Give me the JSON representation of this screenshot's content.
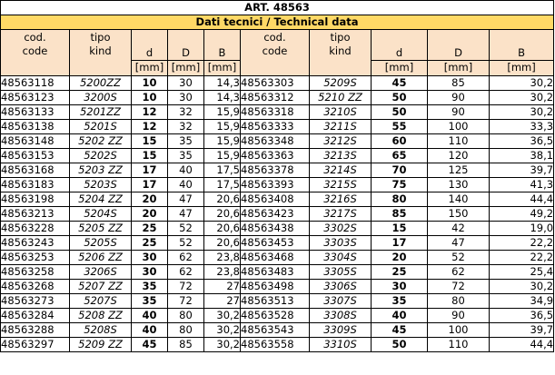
{
  "title": "ART. 48563",
  "subtitle": "Dati tecnici / Technical data",
  "headers": {
    "code_it": "cod.",
    "code_en": "code",
    "kind_it": "tipo",
    "kind_en": "kind",
    "d": "d",
    "D": "D",
    "B": "B",
    "unit": "[mm]"
  },
  "left": [
    {
      "code": "48563118",
      "kind": "5200ZZ",
      "d": "10",
      "D": "30",
      "B": "14,3"
    },
    {
      "code": "48563123",
      "kind": "3200S",
      "d": "10",
      "D": "30",
      "B": "14,3"
    },
    {
      "code": "48563133",
      "kind": "5201ZZ",
      "d": "12",
      "D": "32",
      "B": "15,9"
    },
    {
      "code": "48563138",
      "kind": "5201S",
      "d": "12",
      "D": "32",
      "B": "15,9"
    },
    {
      "code": "48563148",
      "kind": "5202 ZZ",
      "d": "15",
      "D": "35",
      "B": "15,9"
    },
    {
      "code": "48563153",
      "kind": "5202S",
      "d": "15",
      "D": "35",
      "B": "15,9"
    },
    {
      "code": "48563168",
      "kind": "5203 ZZ",
      "d": "17",
      "D": "40",
      "B": "17,5"
    },
    {
      "code": "48563183",
      "kind": "5203S",
      "d": "17",
      "D": "40",
      "B": "17,5"
    },
    {
      "code": "48563198",
      "kind": "5204 ZZ",
      "d": "20",
      "D": "47",
      "B": "20,6"
    },
    {
      "code": "48563213",
      "kind": "5204S",
      "d": "20",
      "D": "47",
      "B": "20,6"
    },
    {
      "code": "48563228",
      "kind": "5205 ZZ",
      "d": "25",
      "D": "52",
      "B": "20,6"
    },
    {
      "code": "48563243",
      "kind": "5205S",
      "d": "25",
      "D": "52",
      "B": "20,6"
    },
    {
      "code": "48563253",
      "kind": "5206 ZZ",
      "d": "30",
      "D": "62",
      "B": "23,8"
    },
    {
      "code": "48563258",
      "kind": "3206S",
      "d": "30",
      "D": "62",
      "B": "23,8"
    },
    {
      "code": "48563268",
      "kind": "5207 ZZ",
      "d": "35",
      "D": "72",
      "B": "27"
    },
    {
      "code": "48563273",
      "kind": "5207S",
      "d": "35",
      "D": "72",
      "B": "27"
    },
    {
      "code": "48563284",
      "kind": "5208 ZZ",
      "d": "40",
      "D": "80",
      "B": "30,2"
    },
    {
      "code": "48563288",
      "kind": "5208S",
      "d": "40",
      "D": "80",
      "B": "30,2"
    },
    {
      "code": "48563297",
      "kind": "5209 ZZ",
      "d": "45",
      "D": "85",
      "B": "30,2"
    }
  ],
  "right": [
    {
      "code": "48563303",
      "kind": "5209S",
      "d": "45",
      "D": "85",
      "B": "30,2"
    },
    {
      "code": "48563312",
      "kind": "5210 ZZ",
      "d": "50",
      "D": "90",
      "B": "30,2"
    },
    {
      "code": "48563318",
      "kind": "3210S",
      "d": "50",
      "D": "90",
      "B": "30,2"
    },
    {
      "code": "48563333",
      "kind": "3211S",
      "d": "55",
      "D": "100",
      "B": "33,3"
    },
    {
      "code": "48563348",
      "kind": "3212S",
      "d": "60",
      "D": "110",
      "B": "36,5"
    },
    {
      "code": "48563363",
      "kind": "3213S",
      "d": "65",
      "D": "120",
      "B": "38,1"
    },
    {
      "code": "48563378",
      "kind": "3214S",
      "d": "70",
      "D": "125",
      "B": "39,7"
    },
    {
      "code": "48563393",
      "kind": "3215S",
      "d": "75",
      "D": "130",
      "B": "41,3"
    },
    {
      "code": "48563408",
      "kind": "3216S",
      "d": "80",
      "D": "140",
      "B": "44,4"
    },
    {
      "code": "48563423",
      "kind": "3217S",
      "d": "85",
      "D": "150",
      "B": "49,2"
    },
    {
      "code": "48563438",
      "kind": "3302S",
      "d": "15",
      "D": "42",
      "B": "19,0"
    },
    {
      "code": "48563453",
      "kind": "3303S",
      "d": "17",
      "D": "47",
      "B": "22,2"
    },
    {
      "code": "48563468",
      "kind": "3304S",
      "d": "20",
      "D": "52",
      "B": "22,2"
    },
    {
      "code": "48563483",
      "kind": "3305S",
      "d": "25",
      "D": "62",
      "B": "25,4"
    },
    {
      "code": "48563498",
      "kind": "3306S",
      "d": "30",
      "D": "72",
      "B": "30,2"
    },
    {
      "code": "48563513",
      "kind": "3307S",
      "d": "35",
      "D": "80",
      "B": "34,9"
    },
    {
      "code": "48563528",
      "kind": "3308S",
      "d": "40",
      "D": "90",
      "B": "36,5"
    },
    {
      "code": "48563543",
      "kind": "3309S",
      "d": "45",
      "D": "100",
      "B": "39,7"
    },
    {
      "code": "48563558",
      "kind": "3310S",
      "d": "50",
      "D": "110",
      "B": "44,4"
    }
  ]
}
